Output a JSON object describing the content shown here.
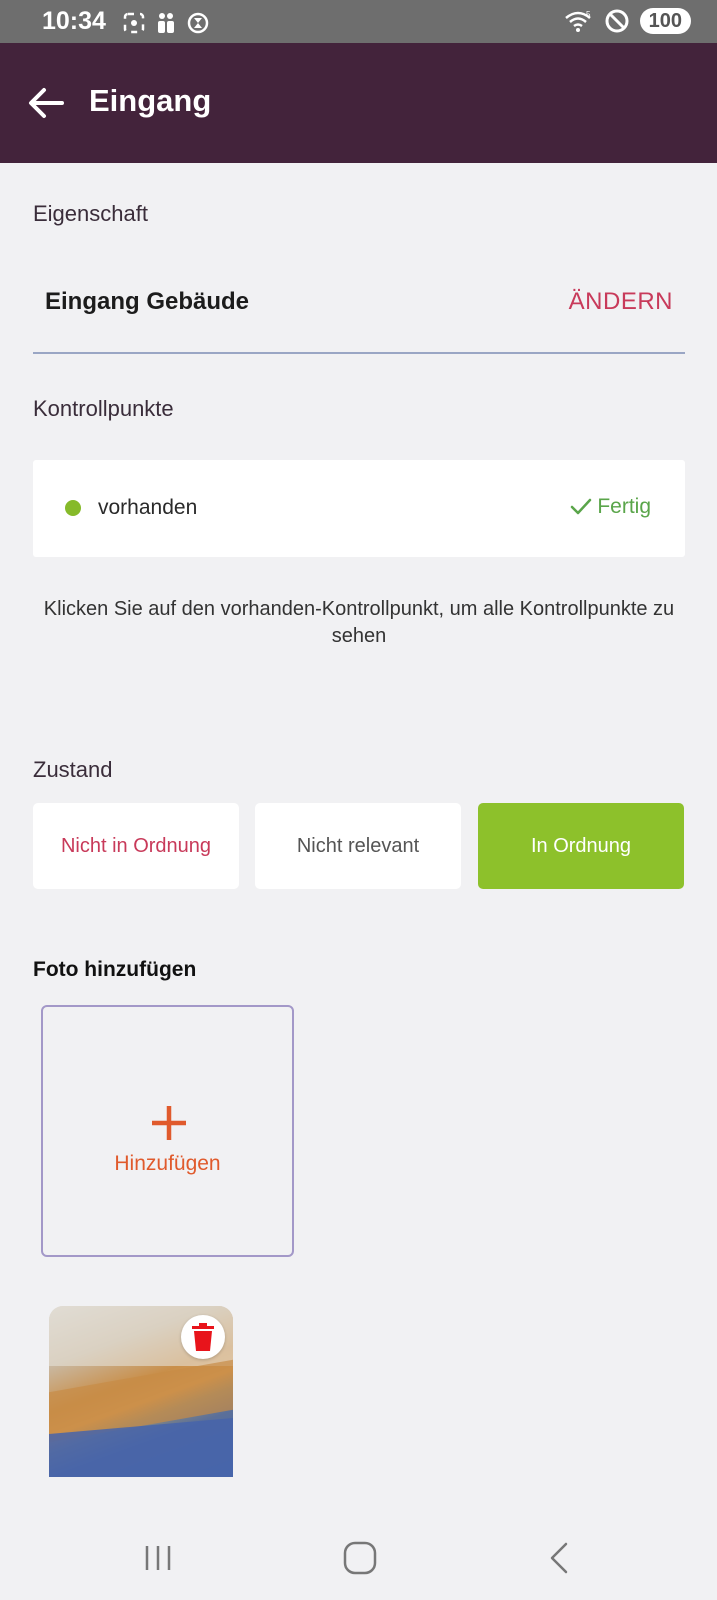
{
  "status_bar": {
    "time": "10:34",
    "battery": "100",
    "icons": [
      "screenshot-icon",
      "people-icon",
      "timer-icon",
      "wifi-icon",
      "do-not-disturb-icon"
    ]
  },
  "app_bar": {
    "title": "Eingang",
    "back_icon": "arrow-back-icon"
  },
  "property": {
    "section_label": "Eigenschaft",
    "value": "Eingang Gebäude",
    "change_label": "ÄNDERN"
  },
  "checkpoints": {
    "section_label": "Kontrollpunkte",
    "items": [
      {
        "label": "vorhanden",
        "status": "Fertig",
        "dot_color": "#86ba2a"
      }
    ],
    "hint": "Klicken Sie auf den vorhanden-Kontrollpunkt, um alle Kontrollpunkte zu sehen"
  },
  "condition": {
    "section_label": "Zustand",
    "options": [
      "Nicht in Ordnung",
      "Nicht relevant",
      "In Ordnung"
    ],
    "selected": "In Ordnung"
  },
  "photos": {
    "section_label": "Foto hinzufügen",
    "add_label": "Hinzufügen"
  },
  "colors": {
    "app_bar": "#43233b",
    "accent_red": "#c83a5a",
    "accent_green": "#8dc12b",
    "accent_orange": "#e05a2c"
  }
}
